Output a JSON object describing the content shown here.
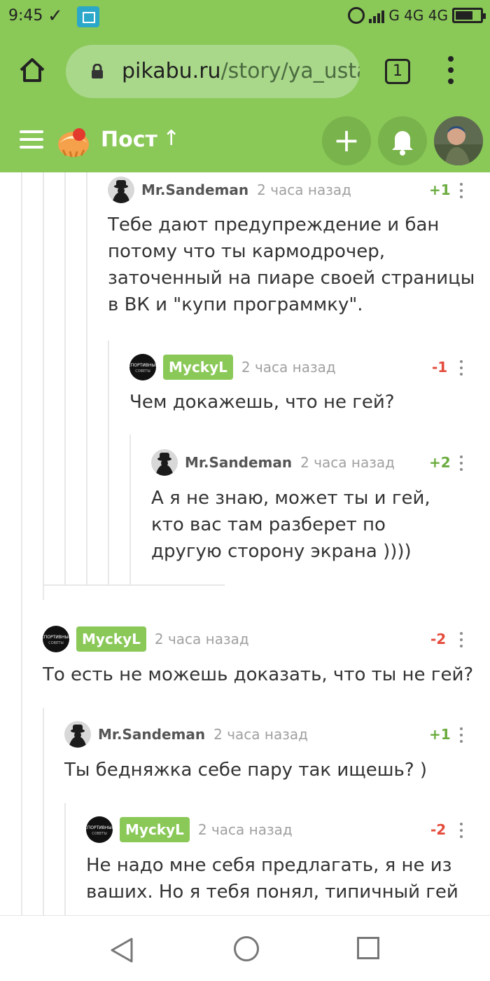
{
  "status_bar": {
    "time": "9:45",
    "right_text": "G 4G 4G",
    "icons": [
      "check-icon",
      "screen-scan-icon",
      "alarm-icon",
      "signal-icon",
      "battery-icon"
    ]
  },
  "browser": {
    "url_domain": "pikabu.ru",
    "url_path": "/story/ya_usta",
    "tab_count": "1",
    "icons": [
      "home-icon",
      "lock-icon",
      "tabs-icon",
      "more-vert-icon"
    ]
  },
  "app_header": {
    "title": "Пост",
    "arrow": "↑",
    "plus_label": "+",
    "icons": [
      "hamburger-menu-icon",
      "pikabu-logo-icon",
      "plus-icon",
      "bell-icon",
      "user-avatar"
    ]
  },
  "comments": [
    {
      "author": "Mr.Sandeman",
      "time": "2 часа назад",
      "rating": "+1",
      "text": "Тебе дают предупреждение и бан потому что ты кармодрочер, заточенный на пиаре своей страницы в ВК и \"купи программку\"."
    },
    {
      "author": "MyckyL",
      "time": "2 часа назад",
      "rating": "-1",
      "text": "Чем докажешь, что не гей?"
    },
    {
      "author": "Mr.Sandeman",
      "time": "2 часа назад",
      "rating": "+2",
      "text": "А я не знаю, может ты и гей, кто вас там разберет по другую сторону экрана ))))"
    },
    {
      "author": "MyckyL",
      "time": "2 часа назад",
      "rating": "-2",
      "text": "То есть не можешь доказать, что ты не гей?"
    },
    {
      "author": "Mr.Sandeman",
      "time": "2 часа назад",
      "rating": "+1",
      "text": "Ты бедняжка себе пару так ищешь? )"
    },
    {
      "author": "MyckyL",
      "time": "2 часа назад",
      "rating": "-2",
      "text": "Не надо мне себя предлагать, я не из ваших. Но я тебя понял, типичный гей"
    }
  ],
  "colors": {
    "brand_green": "#8ac858",
    "positive": "#6bac3f",
    "negative": "#e44b3b"
  },
  "nav_icons": [
    "back-triangle-icon",
    "home-circle-icon",
    "recent-square-icon"
  ]
}
